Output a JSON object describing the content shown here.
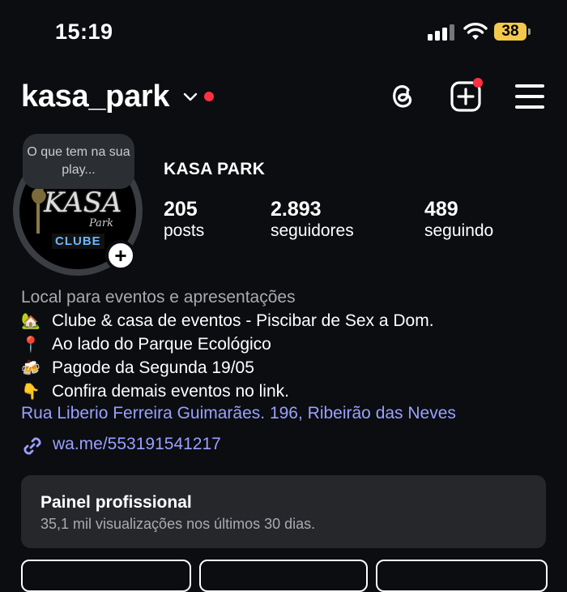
{
  "status_bar": {
    "time": "15:19",
    "battery": "38"
  },
  "header": {
    "username": "kasa_park"
  },
  "profile": {
    "note": "O que tem na sua play...",
    "display_name": "KASA PARK",
    "logo_text": {
      "kasa": "KASA",
      "park": "Park",
      "clube": "CLUBE"
    },
    "stats": [
      {
        "value": "205",
        "label": "posts"
      },
      {
        "value": "2.893",
        "label": "seguidores"
      },
      {
        "value": "489",
        "label": "seguindo"
      }
    ]
  },
  "bio": {
    "category": "Local para eventos e apresentações",
    "lines": [
      {
        "emoji": "🏡",
        "text": "Clube & casa de eventos - Piscibar de Sex a Dom."
      },
      {
        "emoji": "📍",
        "text": "Ao lado do Parque Ecológico"
      },
      {
        "emoji": "🍻",
        "text": "Pagode da Segunda 19/05"
      },
      {
        "emoji": "👇",
        "text": "Confira demais eventos no link."
      }
    ],
    "address": "Rua Liberio Ferreira Guimarães. 196, Ribeirão das Neves",
    "link": "wa.me/553191541217"
  },
  "panel": {
    "title": "Painel profissional",
    "subtitle": "35,1 mil visualizações nos últimos 30 dias."
  },
  "colors": {
    "background": "#0b0d10",
    "link": "#9aa0ff",
    "notification": "#ff3040",
    "battery": "#f2c94c"
  },
  "icons": [
    "signal-icon",
    "wifi-icon",
    "battery-icon",
    "chevron-down-icon",
    "threads-icon",
    "add-post-icon",
    "menu-icon",
    "link-icon",
    "plus-icon"
  ]
}
